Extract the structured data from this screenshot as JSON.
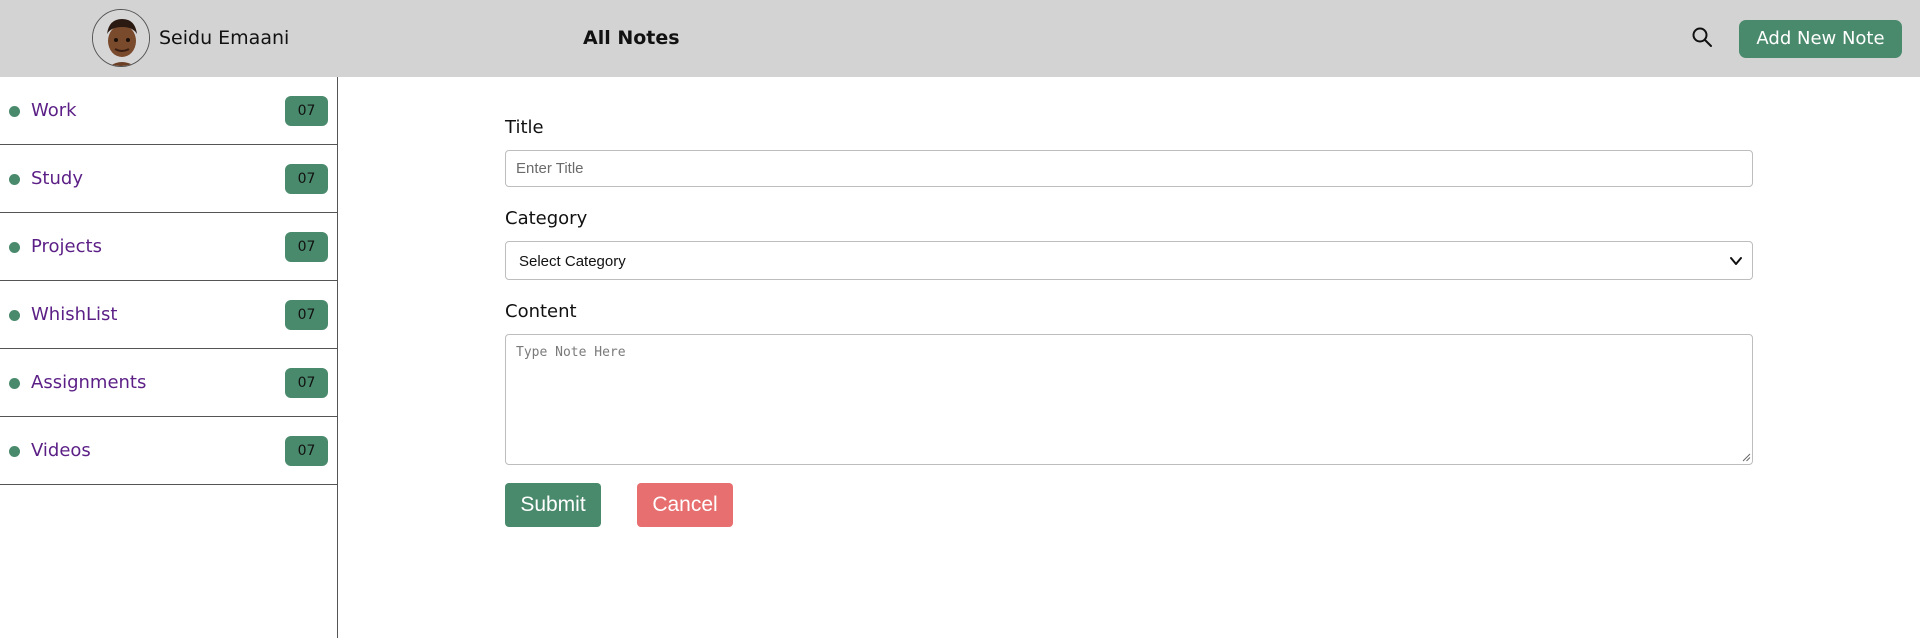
{
  "header": {
    "user_name": "Seidu Emaani",
    "page_title": "All Notes",
    "add_button_label": "Add New Note",
    "search_icon": "search-icon",
    "avatar": "avatar-image"
  },
  "sidebar": {
    "items": [
      {
        "label": "Work",
        "count": "07"
      },
      {
        "label": "Study",
        "count": "07"
      },
      {
        "label": "Projects",
        "count": "07"
      },
      {
        "label": "WhishList",
        "count": "07"
      },
      {
        "label": "Assignments",
        "count": "07"
      },
      {
        "label": "Videos",
        "count": "07"
      }
    ]
  },
  "form": {
    "title_label": "Title",
    "title_placeholder": "Enter Title",
    "title_value": "",
    "category_label": "Category",
    "category_selected": "Select Category",
    "content_label": "Content",
    "content_placeholder": "Type Note Here",
    "content_value": "",
    "submit_label": "Submit",
    "cancel_label": "Cancel"
  },
  "colors": {
    "accent_green": "#4a8a6c",
    "cancel_red": "#e76f6f",
    "header_bg": "#d3d3d3",
    "category_text": "#5b1f86"
  }
}
